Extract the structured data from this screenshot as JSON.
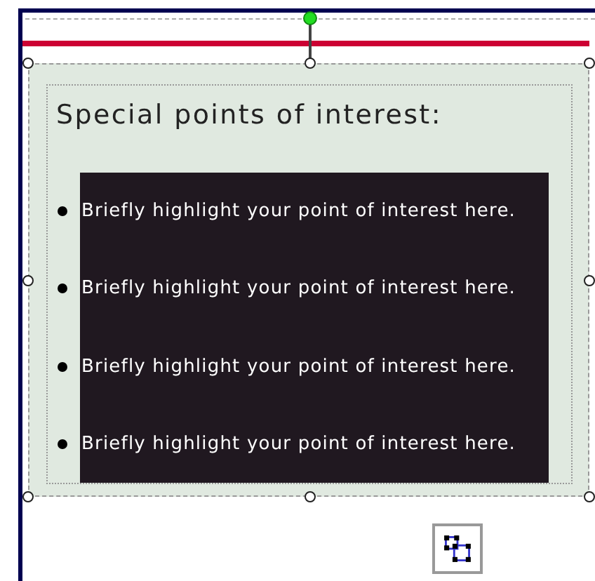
{
  "heading": "Special points of interest:",
  "items": [
    {
      "text": "Briefly highlight your point of interest here."
    },
    {
      "text": "Briefly highlight your point of interest here."
    },
    {
      "text": "Briefly highlight your point of interest here."
    },
    {
      "text": "Briefly highlight your point of interest here."
    }
  ]
}
